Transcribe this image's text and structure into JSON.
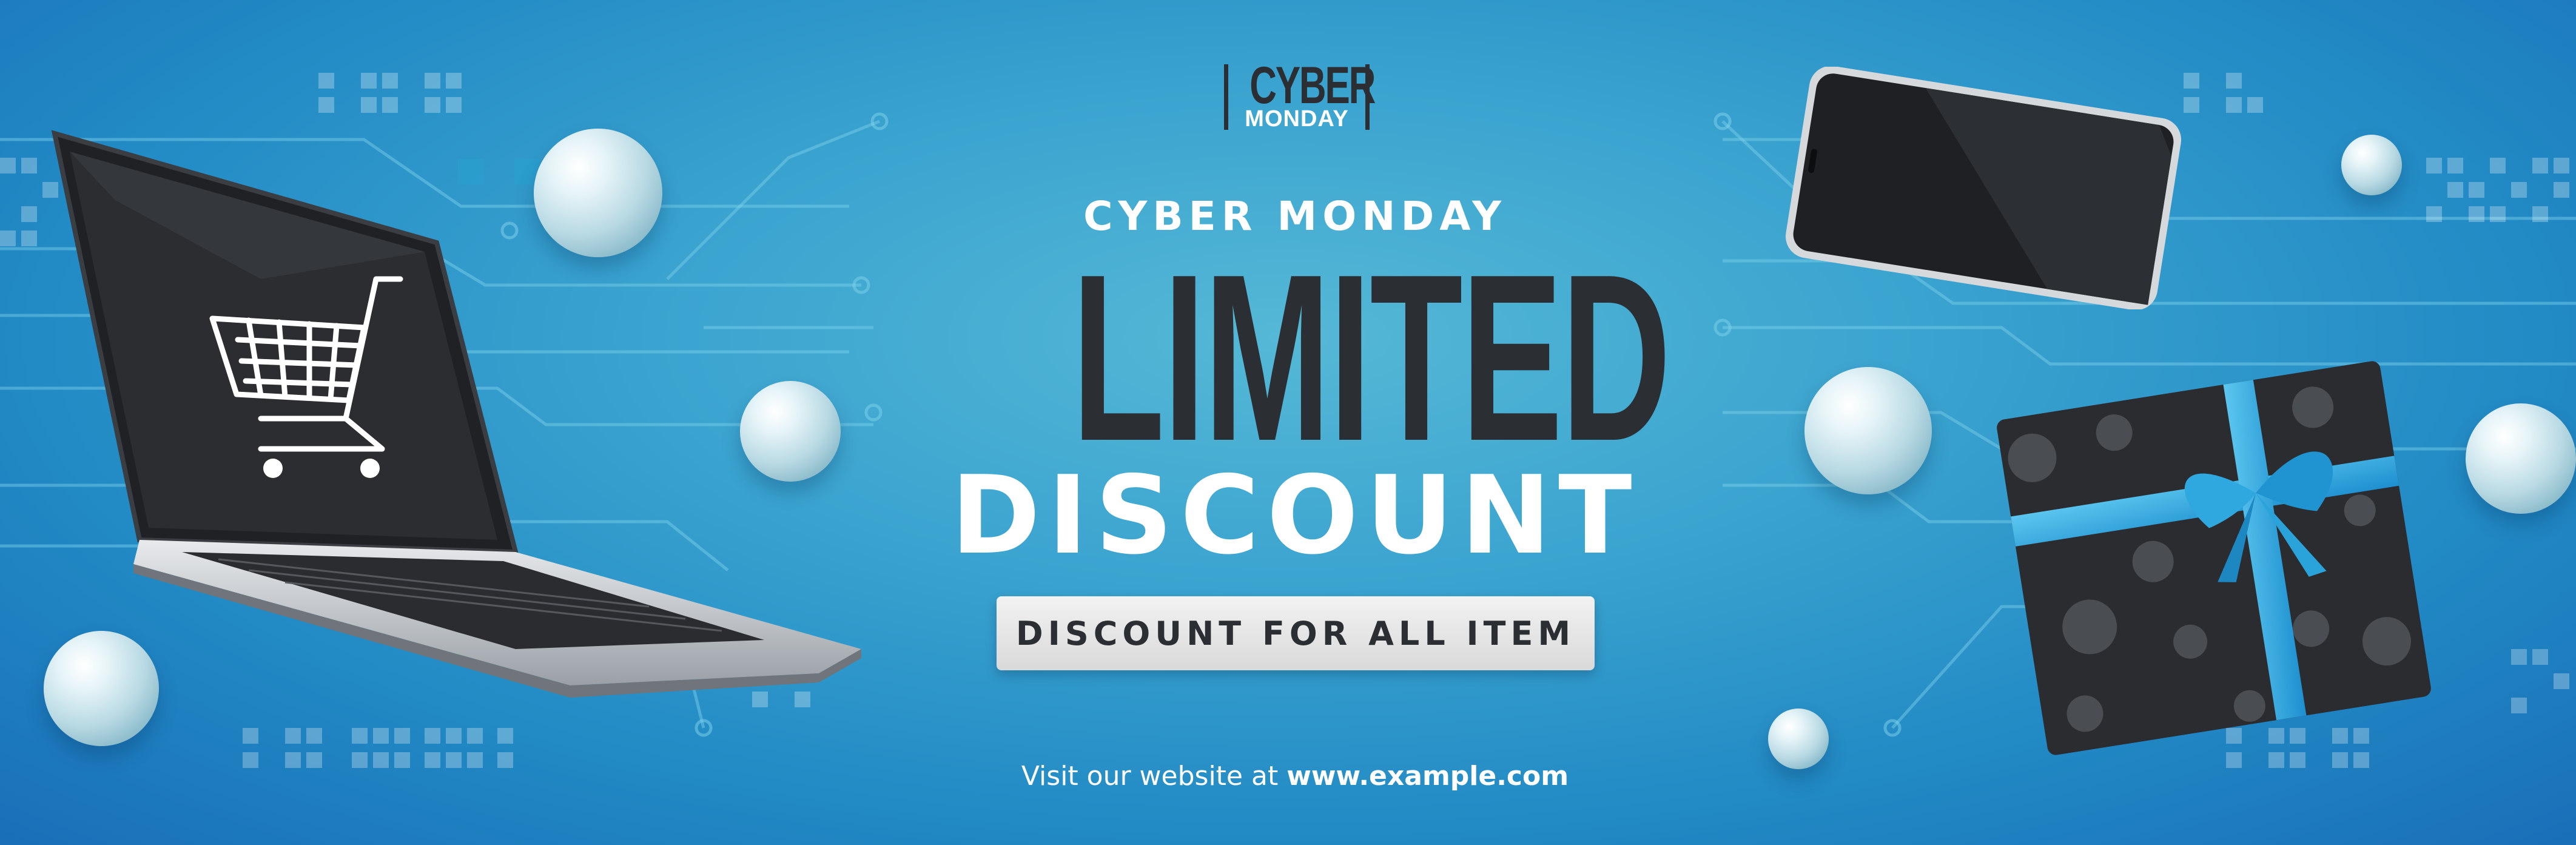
{
  "logo": {
    "word_top": "CYBER",
    "word_bottom": "MONDAY"
  },
  "eyebrow": "CYBER MONDAY",
  "headline_line1": "LIMITED",
  "headline_line2": "DISCOUNT",
  "cta_label": "DISCOUNT FOR ALL ITEM",
  "footer": {
    "prefix": "Visit our website at ",
    "url": "www.example.com"
  },
  "colors": {
    "background": "#3aa3cf",
    "headline_dark": "#2b2f33",
    "white": "#ffffff",
    "ribbon": "#2ba6de"
  },
  "icons": [
    "shopping-cart-icon",
    "laptop-illustration",
    "smartphone-illustration",
    "gift-box-illustration",
    "pearl-decoration"
  ]
}
